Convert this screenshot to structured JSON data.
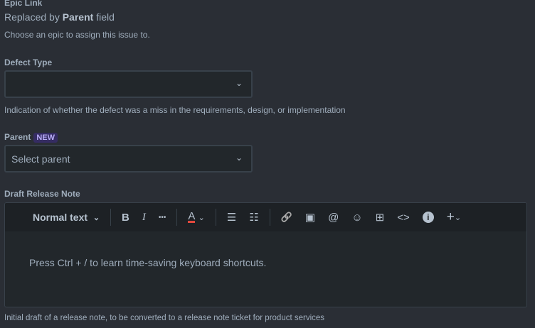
{
  "epic": {
    "label": "Epic Link",
    "replaced_prefix": "Replaced by",
    "replaced_bold": "Parent",
    "replaced_suffix": "field",
    "help": "Choose an epic to assign this issue to."
  },
  "defect": {
    "label": "Defect Type",
    "value": "",
    "help": "Indication of whether the defect was a miss in the requirements, design, or implementation"
  },
  "parent": {
    "label": "Parent",
    "badge": "NEW",
    "placeholder": "Select parent"
  },
  "release": {
    "label": "Draft Release Note",
    "text_style": "Normal text",
    "placeholder": "Press Ctrl + / to learn time-saving keyboard shortcuts.",
    "help": "Initial draft of a release note, to be converted to a release note ticket for product services"
  },
  "icons": {
    "bold": "B",
    "italic": "I",
    "more": "•••",
    "color": "A",
    "bullet": "☰",
    "numbered": "☷",
    "link": "🔗",
    "image": "▣",
    "mention": "@",
    "emoji": "☺",
    "table": "⊞",
    "code": "<>",
    "info": "i",
    "plus": "+"
  }
}
